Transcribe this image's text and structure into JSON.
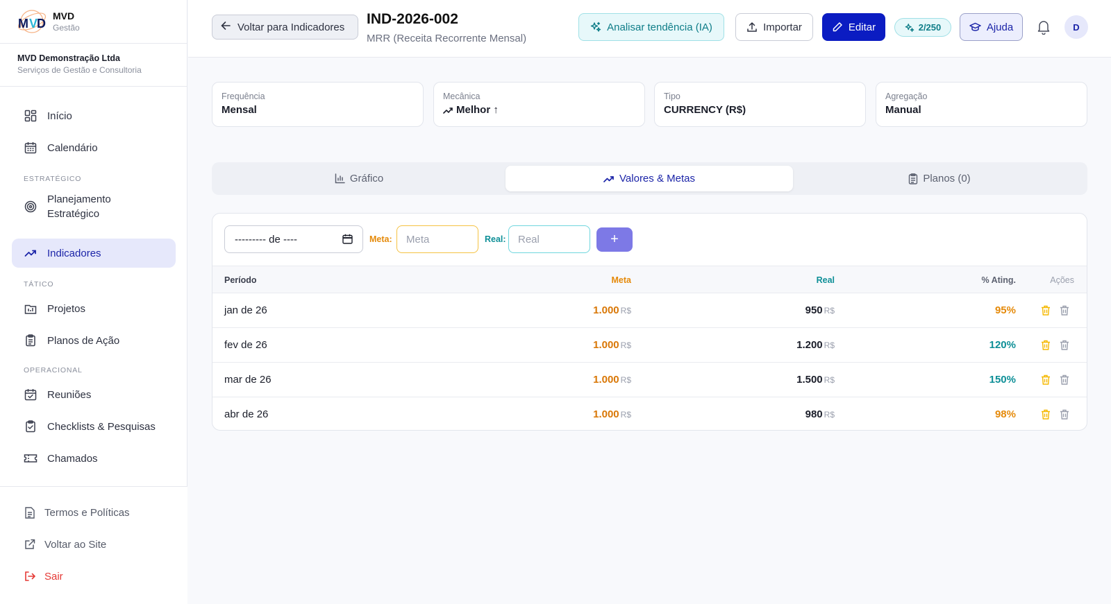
{
  "brand": {
    "name": "MVD",
    "sub": "Gestão"
  },
  "company": {
    "name": "MVD Demonstração Ltda",
    "desc": "Serviços de Gestão e Consultoria"
  },
  "nav": {
    "inicio": "Início",
    "calendario": "Calendário",
    "section_estrategico": "ESTRATÉGICO",
    "planejamento_1": "Planejamento",
    "planejamento_2": "Estratégico",
    "indicadores": "Indicadores",
    "section_tatico": "TÁTICO",
    "projetos": "Projetos",
    "planos": "Planos de Ação",
    "section_operacional": "OPERACIONAL",
    "reunioes": "Reuniões",
    "checklists": "Checklists & Pesquisas",
    "chamados": "Chamados"
  },
  "footer": {
    "termos": "Termos e Políticas",
    "voltar_site": "Voltar ao Site",
    "sair": "Sair"
  },
  "header": {
    "back": "Voltar para Indicadores",
    "title": "IND-2026-002",
    "subtitle": "MRR (Receita Recorrente Mensal)",
    "ia": "Analisar tendência (IA)",
    "importar": "Importar",
    "editar": "Editar",
    "ia_badge": "2/250",
    "ajuda": "Ajuda",
    "avatar": "D"
  },
  "cards": [
    {
      "label": "Frequência",
      "value": "Mensal"
    },
    {
      "label": "Mecânica",
      "value": "Melhor ↑"
    },
    {
      "label": "Tipo",
      "value": "CURRENCY (R$)"
    },
    {
      "label": "Agregação",
      "value": "Manual"
    }
  ],
  "tabs": {
    "grafico": "Gráfico",
    "valores": "Valores & Metas",
    "planos": "Planos (0)"
  },
  "form": {
    "date_text": "--------- de ----",
    "meta_label": "Meta:",
    "meta_placeholder": "Meta",
    "real_label": "Real:",
    "real_placeholder": "Real",
    "add": "+"
  },
  "table": {
    "headers": {
      "periodo": "Período",
      "meta": "Meta",
      "real": "Real",
      "ating": "% Ating.",
      "acoes": "Ações"
    },
    "currency": "R$",
    "rows": [
      {
        "periodo": "jan de 26",
        "meta": "1.000",
        "real": "950",
        "ating": "95%"
      },
      {
        "periodo": "fev de 26",
        "meta": "1.000",
        "real": "1.200",
        "ating": "120%"
      },
      {
        "periodo": "mar de 26",
        "meta": "1.000",
        "real": "1.500",
        "ating": "150%"
      },
      {
        "periodo": "abr de 26",
        "meta": "1.000",
        "real": "980",
        "ating": "98%"
      }
    ]
  },
  "colors": {
    "primary": "#0b1cc2",
    "meta": "#e58a0a",
    "real": "#0e8f97"
  }
}
